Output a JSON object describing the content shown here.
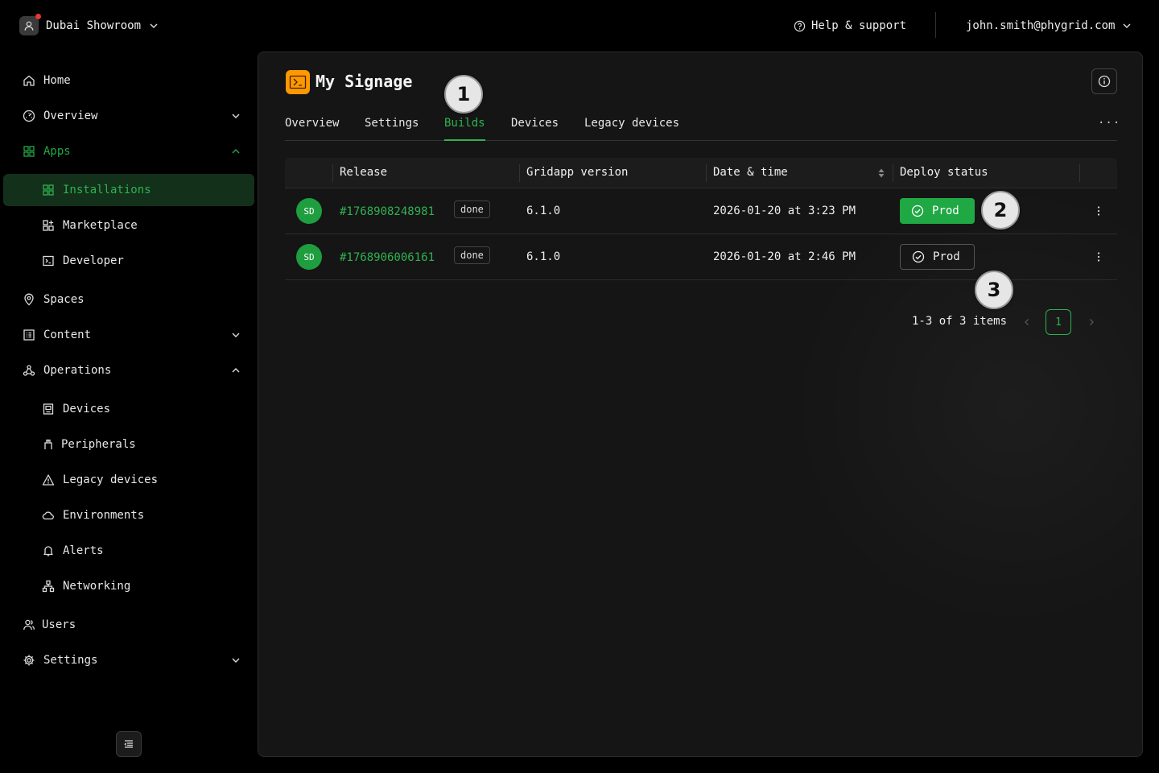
{
  "header": {
    "org_name": "Dubai Showroom",
    "help_label": "Help & support",
    "user_email": "john.smith@phygrid.com"
  },
  "sidebar": {
    "home": "Home",
    "overview": "Overview",
    "apps": "Apps",
    "installations": "Installations",
    "marketplace": "Marketplace",
    "developer": "Developer",
    "spaces": "Spaces",
    "content": "Content",
    "operations": "Operations",
    "devices": "Devices",
    "peripherals": "Peripherals",
    "legacy_devices": "Legacy devices",
    "environments": "Environments",
    "alerts": "Alerts",
    "networking": "Networking",
    "users": "Users",
    "settings": "Settings"
  },
  "main": {
    "title": "My Signage",
    "tabs": [
      "Overview",
      "Settings",
      "Builds",
      "Devices",
      "Legacy devices"
    ],
    "active_tab": "Builds",
    "tab_more": "···"
  },
  "table": {
    "columns": [
      "Release",
      "Gridapp version",
      "Date & time",
      "Deploy status"
    ],
    "rows": [
      {
        "avatar": "SD",
        "release": "#1768908248981",
        "status": "done",
        "version": "6.1.0",
        "datetime": "2026-01-20 at 3:23 PM",
        "deploy": "Prod",
        "deploy_style": "filled"
      },
      {
        "avatar": "SD",
        "release": "#1768906006161",
        "status": "done",
        "version": "6.1.0",
        "datetime": "2026-01-20 at 2:46 PM",
        "deploy": "Prod",
        "deploy_style": "outline"
      }
    ]
  },
  "pagination": {
    "summary": "1-3 of 3 items",
    "current_page": "1"
  },
  "markers": [
    "1",
    "2",
    "3"
  ],
  "colors": {
    "accent_green": "#2eb24f",
    "deploy_green": "#1fa843",
    "app_icon_orange": "#ff9800",
    "active_nav_bg": "#13301b",
    "notification_red": "#e53935"
  }
}
